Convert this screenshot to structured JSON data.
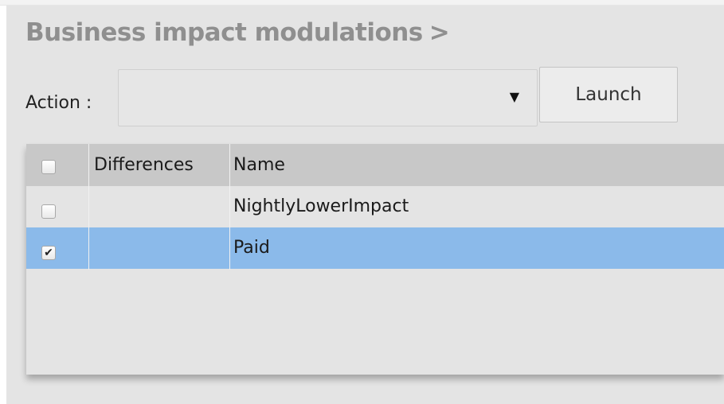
{
  "page": {
    "title": "Business impact modulations",
    "title_chevron": ">"
  },
  "action_bar": {
    "label": "Action :",
    "select_value": "",
    "select_caret": "▼",
    "launch_label": "Launch"
  },
  "table": {
    "columns": {
      "select_all_checked": false,
      "differences": "Differences",
      "name": "Name"
    },
    "rows": [
      {
        "checked": false,
        "check_glyph": "",
        "differences": "",
        "name": "NightlyLowerImpact",
        "selected": false
      },
      {
        "checked": true,
        "check_glyph": "✔",
        "differences": "",
        "name": "Paid",
        "selected": true
      }
    ]
  },
  "colors": {
    "panel_background": "#e4e4e4",
    "header_background": "#c8c8c8",
    "selected_row": "#8bbaea",
    "title_text": "#8f8f8f"
  }
}
